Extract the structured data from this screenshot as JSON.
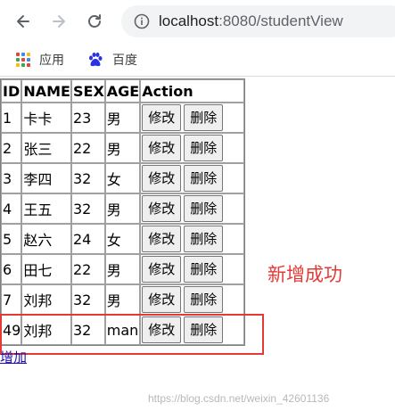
{
  "browser": {
    "url_host": "localhost",
    "url_rest": ":8080/studentView",
    "bookmarks": [
      {
        "label": "应用",
        "icon": "apps-grid-icon"
      },
      {
        "label": "百度",
        "icon": "baidu-paw-icon"
      }
    ]
  },
  "table": {
    "headers": [
      "ID",
      "NAME",
      "SEX",
      "AGE",
      "Action"
    ],
    "rows": [
      {
        "id": "1",
        "name": "卡卡",
        "sex": "23",
        "age": "男"
      },
      {
        "id": "2",
        "name": "张三",
        "sex": "22",
        "age": "男"
      },
      {
        "id": "3",
        "name": "李四",
        "sex": "32",
        "age": "女"
      },
      {
        "id": "4",
        "name": "王五",
        "sex": "32",
        "age": "男"
      },
      {
        "id": "5",
        "name": "赵六",
        "sex": "24",
        "age": "女"
      },
      {
        "id": "6",
        "name": "田七",
        "sex": "22",
        "age": "男"
      },
      {
        "id": "7",
        "name": "刘邦",
        "sex": "32",
        "age": "男"
      },
      {
        "id": "49",
        "name": "刘邦",
        "sex": "32",
        "age": "man"
      }
    ],
    "edit_label": "修改",
    "delete_label": "删除"
  },
  "add_link": "增加",
  "annotation": "新增成功",
  "watermark": "https://blog.csdn.net/weixin_42601136",
  "colors": {
    "annotation": "#e53935",
    "link": "#1a0dab"
  }
}
